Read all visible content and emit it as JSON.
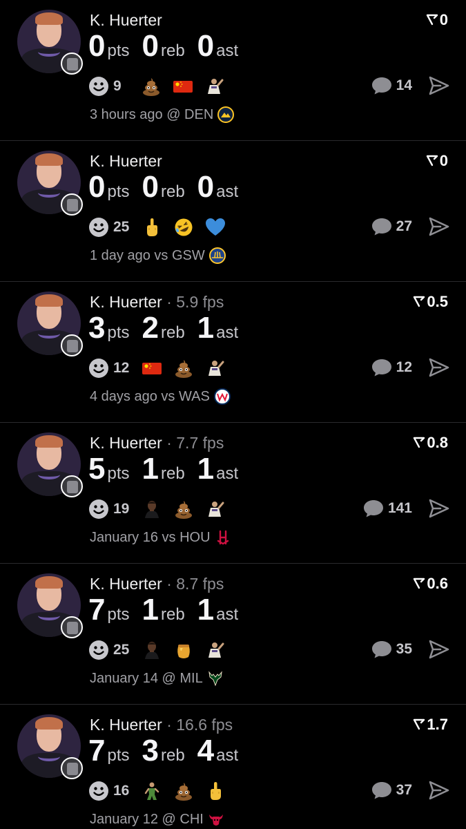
{
  "feed": {
    "cards": [
      {
        "player": "K. Huerter",
        "fps": "",
        "trend": "0",
        "stats": [
          {
            "value": "0",
            "unit": "pts"
          },
          {
            "value": "0",
            "unit": "reb"
          },
          {
            "value": "0",
            "unit": "ast"
          }
        ],
        "reactions_count": "9",
        "reaction_emojis": [
          "poop-emoji",
          "china-flag-emoji",
          "player-photo-emoji"
        ],
        "comments": "14",
        "game": "3 hours ago @ DEN",
        "team_logo": "denver-nuggets-logo"
      },
      {
        "player": "K. Huerter",
        "fps": "",
        "trend": "0",
        "stats": [
          {
            "value": "0",
            "unit": "pts"
          },
          {
            "value": "0",
            "unit": "reb"
          },
          {
            "value": "0",
            "unit": "ast"
          }
        ],
        "reactions_count": "25",
        "reaction_emojis": [
          "middle-finger-emoji",
          "rolling-laughing-emoji",
          "blue-heart-emoji"
        ],
        "comments": "27",
        "game": "1 day ago vs GSW",
        "team_logo": "golden-state-warriors-logo"
      },
      {
        "player": "K. Huerter",
        "fps": " · 5.9 fps",
        "trend": "0.5",
        "stats": [
          {
            "value": "3",
            "unit": "pts"
          },
          {
            "value": "2",
            "unit": "reb"
          },
          {
            "value": "1",
            "unit": "ast"
          }
        ],
        "reactions_count": "12",
        "reaction_emojis": [
          "china-flag-emoji",
          "poop-emoji",
          "player-photo-emoji"
        ],
        "comments": "12",
        "game": "4 days ago vs WAS",
        "team_logo": "washington-wizards-logo"
      },
      {
        "player": "K. Huerter",
        "fps": " · 7.7 fps",
        "trend": "0.8",
        "stats": [
          {
            "value": "5",
            "unit": "pts"
          },
          {
            "value": "1",
            "unit": "reb"
          },
          {
            "value": "1",
            "unit": "ast"
          }
        ],
        "reactions_count": "19",
        "reaction_emojis": [
          "player-face-emoji",
          "poop-emoji",
          "player-photo-emoji"
        ],
        "comments": "141",
        "game": "January 16 vs HOU",
        "team_logo": "houston-rockets-logo"
      },
      {
        "player": "K. Huerter",
        "fps": " · 8.7 fps",
        "trend": "0.6",
        "stats": [
          {
            "value": "7",
            "unit": "pts"
          },
          {
            "value": "1",
            "unit": "reb"
          },
          {
            "value": "1",
            "unit": "ast"
          }
        ],
        "reactions_count": "25",
        "reaction_emojis": [
          "player-face-emoji",
          "honey-pot-emoji",
          "player-photo-emoji"
        ],
        "comments": "35",
        "game": "January 14 @ MIL",
        "team_logo": "milwaukee-bucks-logo"
      },
      {
        "player": "K. Huerter",
        "fps": " · 16.6 fps",
        "trend": "1.7",
        "stats": [
          {
            "value": "7",
            "unit": "pts"
          },
          {
            "value": "3",
            "unit": "reb"
          },
          {
            "value": "4",
            "unit": "ast"
          }
        ],
        "reactions_count": "16",
        "reaction_emojis": [
          "green-figure-emoji",
          "poop-emoji",
          "middle-finger-emoji"
        ],
        "comments": "37",
        "game": "January 12 @ CHI",
        "team_logo": "chicago-bulls-logo"
      }
    ]
  },
  "colors": {
    "background": "#000000",
    "divider": "#2a2a2d",
    "secondary_text": "#8e8e93",
    "icon_gray": "#8e8e93"
  }
}
